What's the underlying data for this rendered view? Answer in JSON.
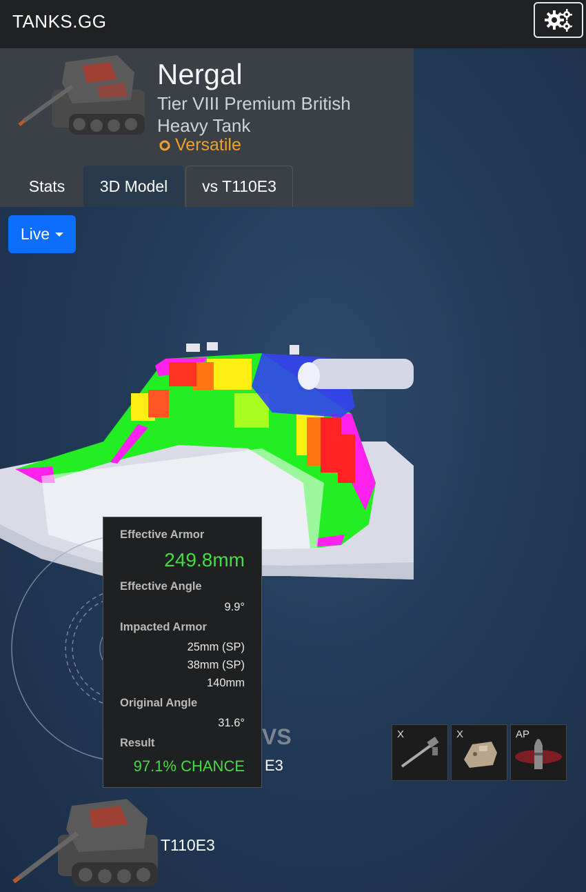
{
  "app": {
    "brand": "TANKS.GG"
  },
  "tank": {
    "name": "Nergal",
    "description": "Tier VIII Premium British Heavy Tank",
    "role": "Versatile"
  },
  "tabs": [
    {
      "label": "Stats",
      "active": false
    },
    {
      "label": "3D Model",
      "active": true
    },
    {
      "label": "vs T110E3",
      "active": false
    }
  ],
  "version_dropdown": {
    "selected": "Live"
  },
  "tooltip": {
    "effective_armor_label": "Effective Armor",
    "effective_armor_value": "249.8mm",
    "effective_angle_label": "Effective Angle",
    "effective_angle_value": "9.9°",
    "impacted_armor_label": "Impacted Armor",
    "impacted_armor_values": [
      "25mm (SP)",
      "38mm (SP)",
      "140mm"
    ],
    "original_angle_label": "Original Angle",
    "original_angle_value": "31.6°",
    "result_label": "Result",
    "result_value": "97.1% CHANCE"
  },
  "comparison": {
    "vs_label": "VS",
    "opponent_partial": "E3",
    "opponent_name": "T110E3",
    "modules": [
      {
        "label": "X",
        "icon": "gun-icon"
      },
      {
        "label": "X",
        "icon": "turret-icon"
      },
      {
        "label": "AP",
        "icon": "ap-shell-icon"
      }
    ]
  },
  "colors": {
    "role": "#f0a030",
    "good_result": "#44dd44",
    "primary_button": "#0d6efd"
  }
}
